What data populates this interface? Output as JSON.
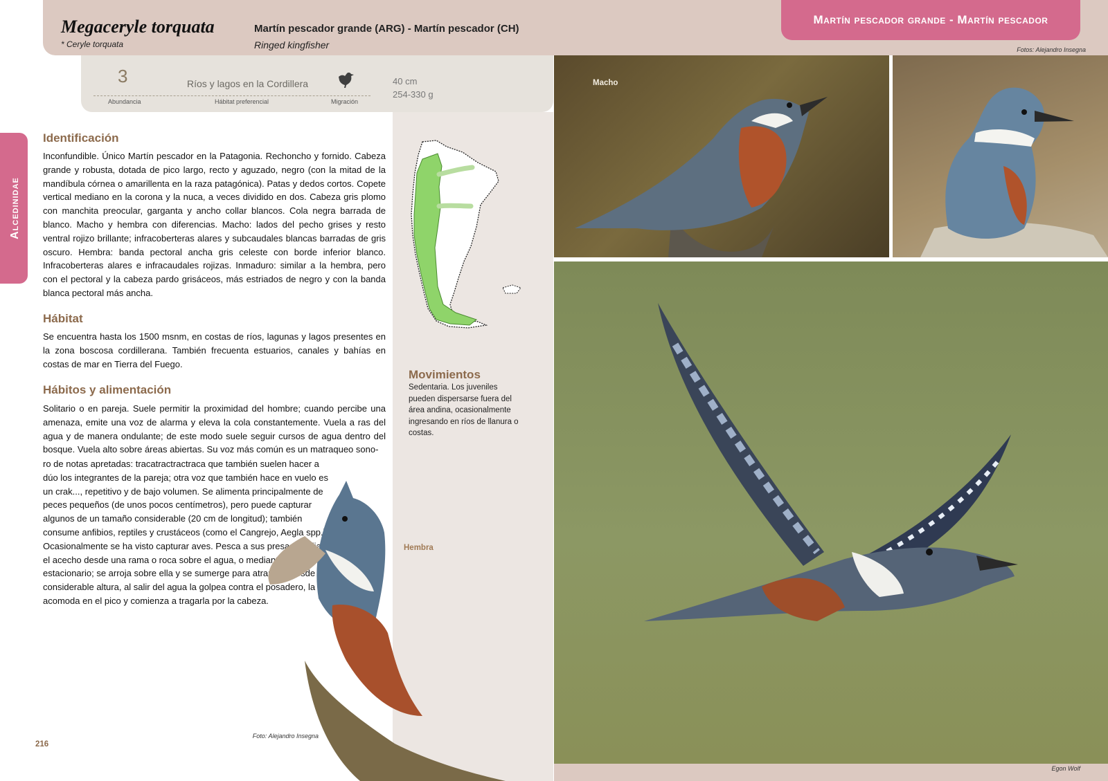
{
  "header": {
    "scientific_name": "Megaceryle torquata",
    "synonym": "* Ceryle torquata",
    "common_names": "Martín pescador grande (ARG) - Martín pescador (CH)",
    "english_name": "Ringed kingfisher",
    "title_tab": "Martín pescador grande - Martín pescador",
    "photo_credit": "Fotos: Alejandro Insegna"
  },
  "info_strip": {
    "abundance_value": "3",
    "abundance_label": "Abundancia",
    "habitat_value": "Ríos y lagos en la Cordillera",
    "habitat_label": "Hábitat preferencial",
    "migration_label": "Migración",
    "migration_icon": "bird-silhouette-icon",
    "size": "40 cm",
    "weight": "254-330 g"
  },
  "family_tab": "Alcedinidae",
  "identification": {
    "heading": "Identificación",
    "text": "Inconfundible. Único Martín pescador en la Patagonia. Rechoncho y fornido. Cabeza grande y robusta, dotada de pico largo, recto y aguzado, negro (con la mitad de la mandíbula córnea o amarillenta en la raza patagónica). Patas y dedos cortos. Copete vertical mediano en la corona y la nuca, a veces dividido en dos. Cabeza gris plomo con manchita preocular, garganta y ancho collar blancos. Cola negra barrada de blanco. Macho y hembra con diferencias. Macho: lados del pecho grises y resto ventral rojizo brillante; infracoberteras alares y subcaudales blancas barradas de gris oscuro. Hembra: banda pectoral ancha gris celeste con borde inferior blanco. Infracoberteras alares e infracaudales rojizas. Inmaduro: similar a la hembra, pero con el pectoral y la cabeza pardo grisáceos, más estriados de negro y con la banda blanca pectoral más ancha."
  },
  "habitat": {
    "heading": "Hábitat",
    "text": "Se encuentra hasta los 1500 msnm, en costas de ríos, lagunas y lagos presentes en la zona boscosa cordillerana. También frecuenta estuarios, canales y bahías en costas de mar en Tierra del Fuego."
  },
  "habits": {
    "heading": "Hábitos y alimentación",
    "text_full": "Solitario o en pareja. Suele permitir la proximidad del hombre; cuando percibe una amenaza, emite una voz de alarma y eleva la cola constantemente. Vuela a ras del agua y de manera ondulante; de este modo suele seguir cursos de agua dentro del bosque. Vuela alto sobre áreas abiertas. Su voz más común es un matraqueo sono-",
    "text_narrow": "ro de notas apretadas: tracatractractraca que también suelen hacer a dúo los integrantes de la pareja; otra voz que también hace en vuelo es un crak..., repetitivo y de bajo volumen. Se alimenta principalmente de peces pequeños (de unos pocos centímetros), pero puede capturar algunos de un tamaño considerable (20 cm de longitud); también consume anfibios, reptiles y crustáceos (como el Cangrejo, Aegla spp.). Ocasionalmente se ha visto capturar aves. Pesca a sus presas mediante el acecho desde una rama o roca sobre el agua, o mediante vuelo estacionario; se arroja sobre ella y se sumerge para atraparla desde considerable altura, al salir del agua la golpea contra el posadero, la acomoda en el pico y comienza a tragarla por la cabeza."
  },
  "movements": {
    "heading": "Movimientos",
    "text": "Sedentaria. Los juveniles pueden dispersarse fuera del área andina, ocasionalmente ingresando en ríos de llanura o costas."
  },
  "photos": {
    "male_label": "Macho",
    "female_label": "Hembra",
    "credit_left": "Foto: Alejandro Insegna",
    "credit_bottom": "Egon Wolf"
  },
  "page_number": "216",
  "colors": {
    "accent_pink": "#d46a8d",
    "band_beige": "#dcc9c1",
    "heading_brown": "#8c6a4c",
    "map_range_green": "#8fd46a"
  }
}
